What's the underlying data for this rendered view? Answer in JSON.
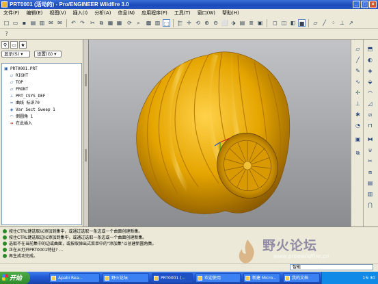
{
  "window": {
    "title": "PRT0001 (活动的) - Pro/ENGINEER Wildfire 3.0",
    "min_glyph": "_",
    "max_glyph": "□",
    "close_glyph": "×"
  },
  "menubar": {
    "items": [
      "文件(F)",
      "编辑(E)",
      "视图(V)",
      "插入(I)",
      "分析(A)",
      "信息(N)",
      "应用程序(P)",
      "工具(T)",
      "窗口(W)",
      "帮助(H)"
    ]
  },
  "left_panel": {
    "show_label": "显示(S) ▾",
    "settings_label": "设置(G) ▾",
    "tree": [
      {
        "icon": "part-icon",
        "glyph": "▣",
        "label": "PRT0001.PRT"
      },
      {
        "icon": "datum-plane-icon",
        "glyph": "▱",
        "label": "RIGHT"
      },
      {
        "icon": "datum-plane-icon",
        "glyph": "▱",
        "label": "TOP"
      },
      {
        "icon": "datum-plane-icon",
        "glyph": "▱",
        "label": "FRONT"
      },
      {
        "icon": "coord-sys-icon",
        "glyph": "⊥",
        "label": "PRT_CSYS_DEF"
      },
      {
        "icon": "curve-icon",
        "glyph": "≈",
        "label": "曲线 标识70"
      },
      {
        "icon": "sweep-icon",
        "glyph": "◈",
        "label": "Var Sect Sweep 1"
      },
      {
        "icon": "round-icon",
        "glyph": "◠",
        "label": "倒圆角 1"
      },
      {
        "icon": "insert-here-icon",
        "glyph": "➜",
        "label": "在此插入"
      }
    ]
  },
  "messages": [
    {
      "color": "#2a8a2a",
      "text": "按住CTRL键选取以添加到集中，或通过选取一条边或一个曲面创建新集。"
    },
    {
      "color": "#2a8a2a",
      "text": "按住CTRL键选取边以添加到集中，或通过选取一条边或一个曲面创建新集。"
    },
    {
      "color": "#2a8a2a",
      "text": "选取不在当前集中的边或曲面，或按取弹出式菜单中的\"添加集\"以创建新圆角集。"
    },
    {
      "color": "#2a8a2a",
      "text": "正在从打开PRT0001特征? ..."
    },
    {
      "color": "#2a8a2a",
      "text": "再生成功完成。"
    }
  ],
  "status": {
    "smart_select": "智能"
  },
  "taskbar": {
    "start_label": "开始",
    "tasks": [
      "Apabi Rea...",
      "野火论坛",
      "PRT0001 (...",
      "欢迎使用",
      "新建 Micro...",
      "我的文档"
    ],
    "clock": "15:30"
  },
  "watermark": {
    "text": "野火论坛",
    "url": "www.proewildfire.cn"
  },
  "colors": {
    "model": "#e0a000",
    "viewport_bg": "#a0a1a5",
    "titlebar": "#1c49b8"
  }
}
